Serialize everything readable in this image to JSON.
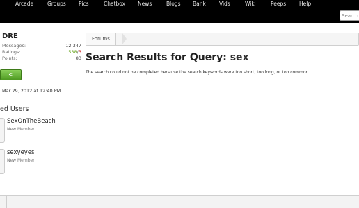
{
  "nav": {
    "items": [
      {
        "label": "Arcade"
      },
      {
        "label": "Groups"
      },
      {
        "label": "Pics"
      },
      {
        "label": "Chatbox"
      },
      {
        "label": "News"
      },
      {
        "label": "Blogs"
      },
      {
        "label": "Bank"
      },
      {
        "label": "Vids"
      },
      {
        "label": "Wiki"
      },
      {
        "label": "Peeps"
      },
      {
        "label": "Help"
      }
    ],
    "search_placeholder": "Search"
  },
  "sidebar": {
    "username": "DRE",
    "stats": {
      "messages_label": "Messages:",
      "messages_value": "12,347",
      "ratings_label": "Ratings:",
      "ratings_good": "538",
      "ratings_sep": "/",
      "ratings_bad": "3",
      "points_label": "Points:",
      "points_value": "83"
    },
    "button_label": "<",
    "date": "Mar 29, 2012 at 12:40 PM",
    "section_heading": "ed Users",
    "users": [
      {
        "name": "SexOnTheBeach",
        "title": "New Member"
      },
      {
        "name": "sexyeyes",
        "title": "New Member"
      }
    ]
  },
  "breadcrumb": {
    "items": [
      {
        "label": "Forums"
      }
    ]
  },
  "main": {
    "title_prefix": "Search Results for Query: ",
    "query": "sex",
    "message": "The search could not be completed because the search keywords were too short, too long, or too common."
  },
  "colors": {
    "navbar": "#000000",
    "rating_good": "#66a31a",
    "rating_bad": "#cc1111",
    "button_green": "#5fae2e"
  }
}
